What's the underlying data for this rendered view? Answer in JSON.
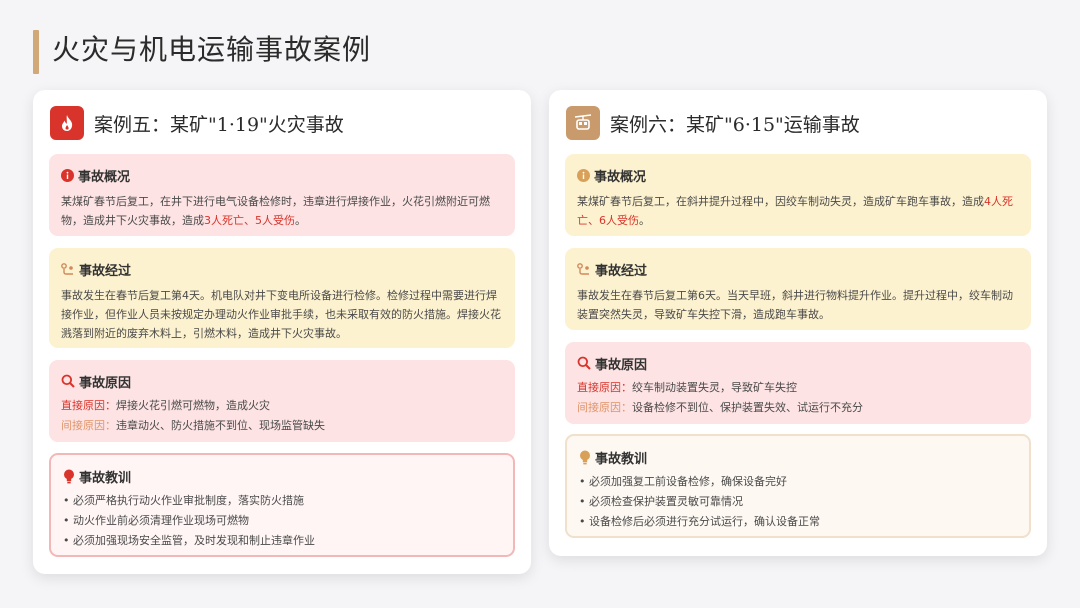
{
  "page_title": "火灾与机电运输事故案例",
  "cases": [
    {
      "title": "案例五：某矿\"1·19\"火灾事故",
      "icon": "flame-icon",
      "overview": {
        "title": "事故概况",
        "text_before": "某煤矿春节后复工，在井下进行电气设备检修时，违章进行焊接作业，火花引燃附近可燃物，造成井下火灾事故，造成",
        "highlight": "3人死亡、5人受伤",
        "text_after": "。"
      },
      "process": {
        "title": "事故经过",
        "text": "事故发生在春节后复工第4天。机电队对井下变电所设备进行检修。检修过程中需要进行焊接作业，但作业人员未按规定办理动火作业审批手续，也未采取有效的防火措施。焊接火花溅落到附近的废弃木料上，引燃木料，造成井下火灾事故。"
      },
      "causes": {
        "title": "事故原因",
        "direct_label": "直接原因：",
        "direct": "焊接火花引燃可燃物，造成火灾",
        "indirect_label": "间接原因：",
        "indirect": "违章动火、防火措施不到位、现场监管缺失"
      },
      "lessons": {
        "title": "事故教训",
        "items": [
          "必须严格执行动火作业审批制度，落实防火措施",
          "动火作业前必须清理作业现场可燃物",
          "必须加强现场安全监管，及时发现和制止违章作业"
        ]
      }
    },
    {
      "title": "案例六：某矿\"6·15\"运输事故",
      "icon": "cable-car-icon",
      "overview": {
        "title": "事故概况",
        "text_before": "某煤矿春节后复工，在斜井提升过程中，因绞车制动失灵，造成矿车跑车事故，造成",
        "highlight": "4人死亡、6人受伤",
        "text_after": "。"
      },
      "process": {
        "title": "事故经过",
        "text": "事故发生在春节后复工第6天。当天早班，斜井进行物料提升作业。提升过程中，绞车制动装置突然失灵，导致矿车失控下滑，造成跑车事故。"
      },
      "causes": {
        "title": "事故原因",
        "direct_label": "直接原因：",
        "direct": "绞车制动装置失灵，导致矿车失控",
        "indirect_label": "间接原因：",
        "indirect": "设备检修不到位、保护装置失效、试运行不充分"
      },
      "lessons": {
        "title": "事故教训",
        "items": [
          "必须加强复工前设备检修，确保设备完好",
          "必须检查保护装置灵敏可靠情况",
          "设备检修后必须进行充分试运行，确认设备正常"
        ]
      }
    }
  ]
}
